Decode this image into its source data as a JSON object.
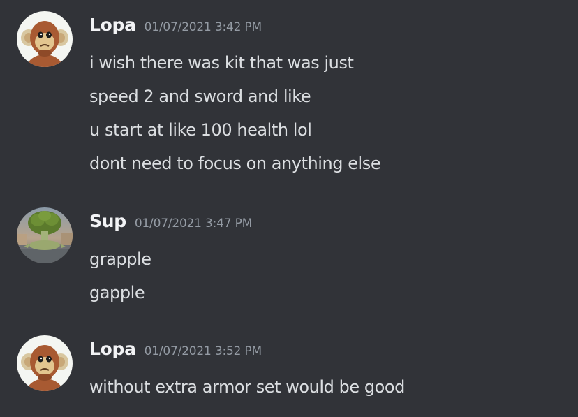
{
  "messages": [
    {
      "username": "Lopa",
      "timestamp": "01/07/2021 3:42 PM",
      "avatar_icon": "monkey-avatar",
      "lines": [
        "i wish there was kit that was just",
        "speed 2 and sword and like",
        "u start at like 100 health lol",
        "dont need to focus on anything else"
      ]
    },
    {
      "username": "Sup",
      "timestamp": "01/07/2021 3:47 PM",
      "avatar_icon": "broccoli-turtle-avatar",
      "lines": [
        "grapple",
        "gapple"
      ]
    },
    {
      "username": "Lopa",
      "timestamp": "01/07/2021 3:52 PM",
      "avatar_icon": "monkey-avatar",
      "lines": [
        "without extra armor set would be good"
      ]
    }
  ],
  "colors": {
    "background": "#313338",
    "username": "#f2f3f5",
    "timestamp": "#949ba4",
    "message_text": "#dbdee1"
  }
}
